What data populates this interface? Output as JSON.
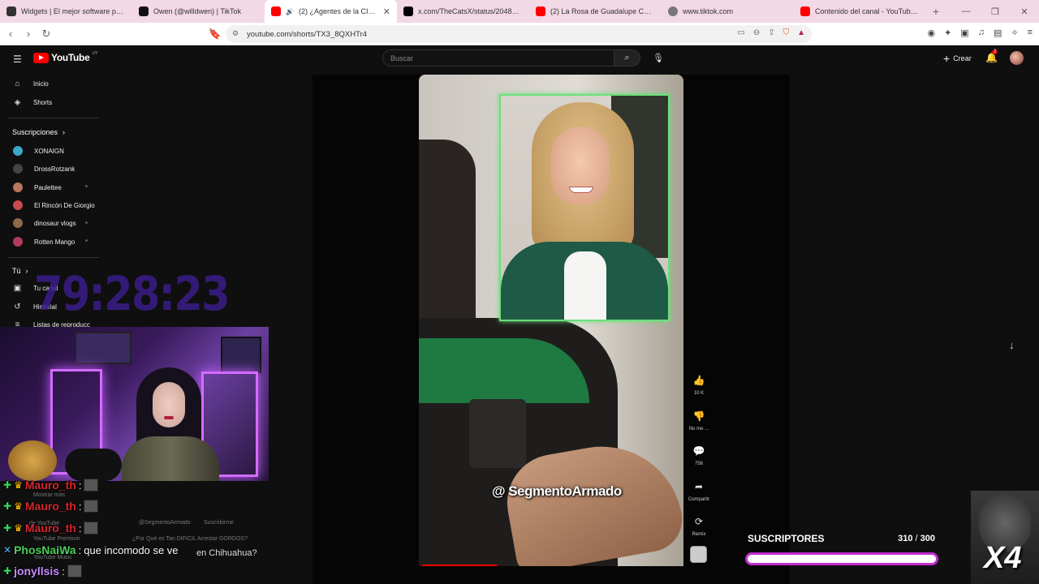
{
  "browser": {
    "tabs": [
      {
        "title": "Widgets | El mejor software para pod",
        "color": "#333333"
      },
      {
        "title": "Owen (@willdwen) | TikTok",
        "color": "#111111"
      },
      {
        "title": "(2) ¿Agentes de la CIA en Chi",
        "color": "#ff0000",
        "active": true
      },
      {
        "title": "x.com/TheCatsX/status/2048358426",
        "color": "#000000"
      },
      {
        "title": "(2) La Rosa de Guadalupe Capitulo E",
        "color": "#ff0000"
      },
      {
        "title": "www.tiktok.com",
        "color": "#777777"
      },
      {
        "title": "Contenido del canal - YouTube Studi",
        "color": "#ff0000"
      }
    ],
    "url": "youtube.com/shorts/TX3_8QXHTr4"
  },
  "youtube": {
    "logo_text": "YouTube",
    "logo_region": "UY",
    "search_placeholder": "Buscar",
    "create_label": "Crear",
    "notif_count": "2",
    "sidebar": {
      "home": "Inicio",
      "shorts": "Shorts",
      "subs_heading": "Suscripciones",
      "subscriptions": [
        {
          "name": "XONAIGN",
          "color": "#3aa7c9"
        },
        {
          "name": "DrossRotzank",
          "color": "#444444"
        },
        {
          "name": "Paulettee",
          "color": "#b9775d"
        },
        {
          "name": "El Rincón De Giorgio",
          "color": "#c94b4b"
        },
        {
          "name": "dinosaur vlogs",
          "color": "#8a6a4a"
        },
        {
          "name": "Rotten Mango",
          "color": "#b43a5e"
        }
      ],
      "you_heading": "Tú",
      "your_channel": "Tu canal",
      "history": "Historial",
      "playlists": "Listas de reproducc"
    },
    "short": {
      "watermark": "@ SegmentoArmado",
      "likes": "10 K",
      "dislike_label": "No me ...",
      "comments": "756",
      "share_label": "Compartir",
      "remix_label": "Remix"
    }
  },
  "overlay": {
    "timer": "79:28:23",
    "chat": [
      {
        "user": "Mauro_th",
        "text": "",
        "style": "red"
      },
      {
        "user": "Mauro_th",
        "text": "",
        "style": "red"
      },
      {
        "user": "Mauro_th",
        "text": "",
        "style": "red"
      },
      {
        "user": "PhosNaiWa",
        "text": "que incomodo se ve",
        "style": "green"
      },
      {
        "user": "jonyllsis",
        "text": "",
        "style": "purple"
      }
    ],
    "ghost_texts": {
      "mostrar_mas": "Mostrar más",
      "channel": "@SegmentoArmado",
      "subscribe": "Suscribirme",
      "next_title": "¿Por Qué es Tan DIFICIL Arrestar GORDOS?",
      "chihuahua": "en Chihuahua?",
      "premium": "YouTube Premium",
      "music": "YouTube Music",
      "de_yt": "de YouTube"
    },
    "subs_goal": {
      "label": "SUSCRIPTORES",
      "current": "310",
      "separator": "/",
      "target": "300",
      "progress": 1.0
    },
    "multiplier": "X4"
  }
}
